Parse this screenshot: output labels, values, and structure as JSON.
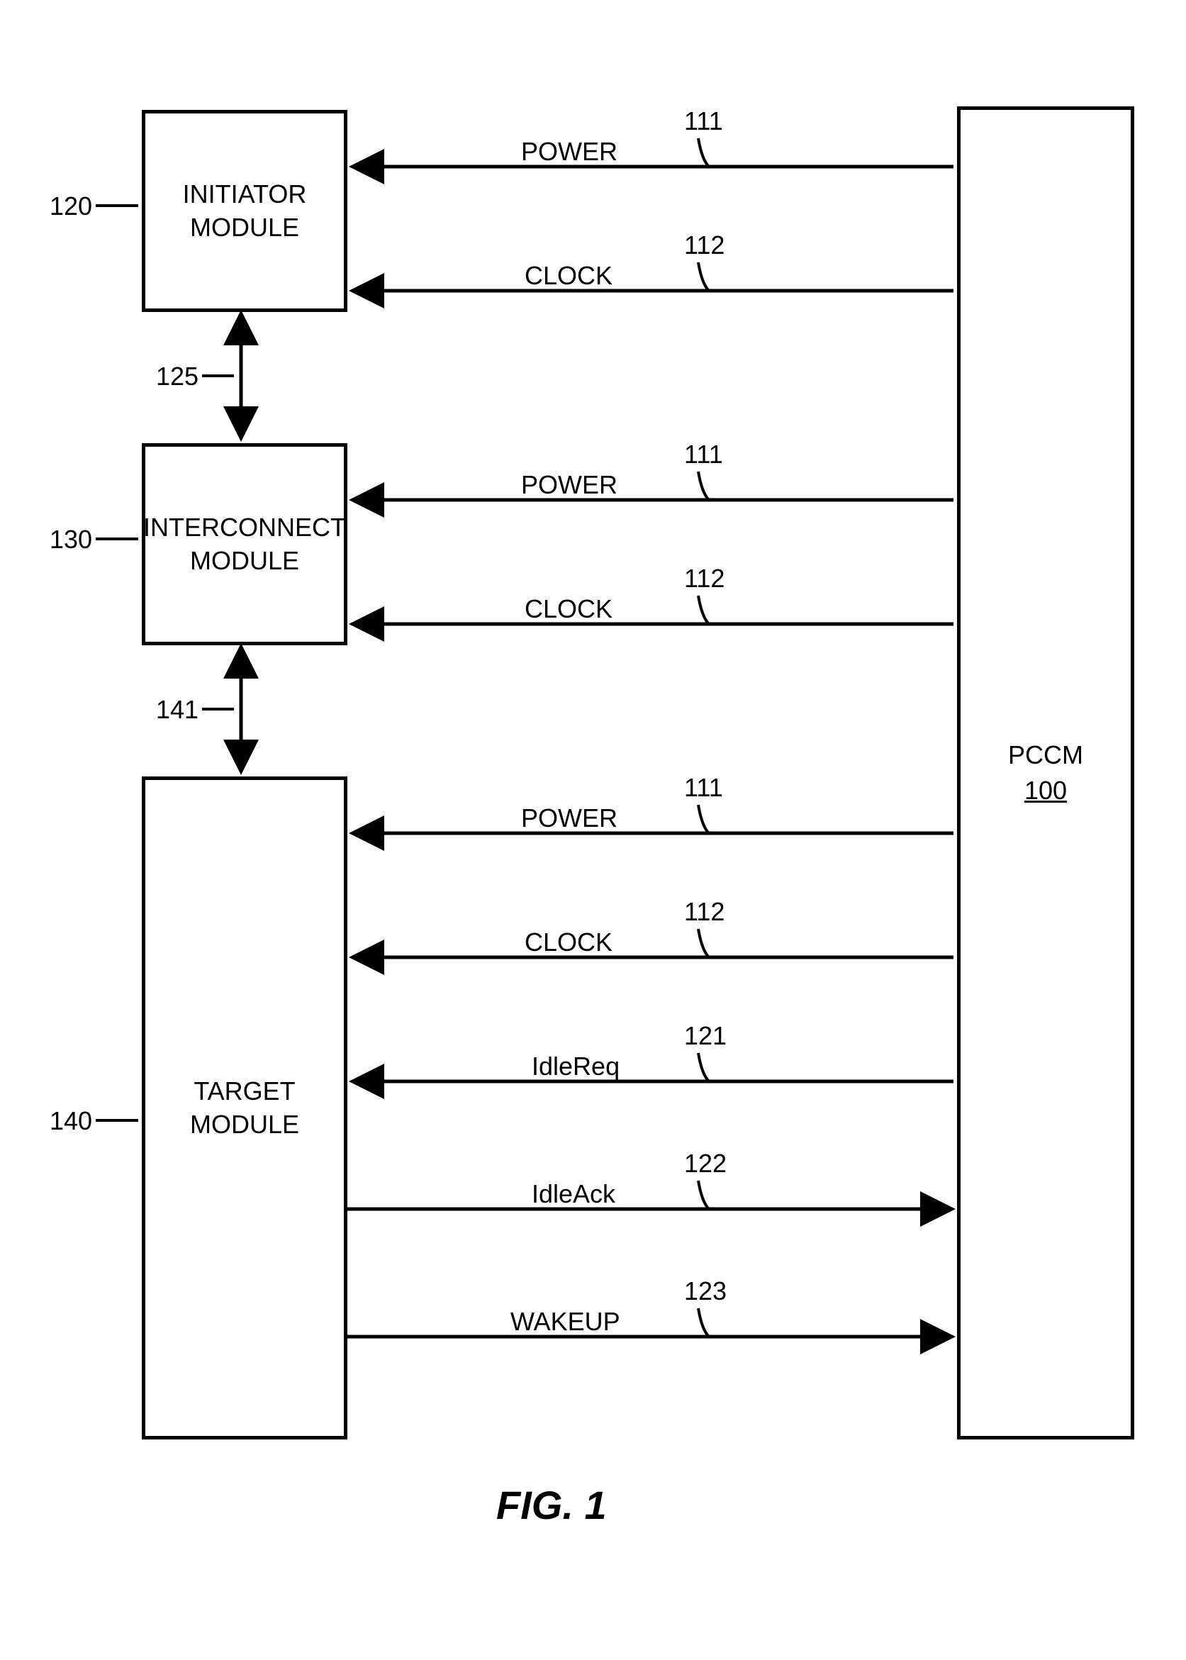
{
  "figure_label": "FIG. 1",
  "boxes": {
    "initiator": "INITIATOR\nMODULE",
    "interconnect": "INTERCONNECT\nMODULE",
    "target": "TARGET\nMODULE",
    "pccm_title": "PCCM",
    "pccm_num": "100"
  },
  "refs": {
    "initiator": "120",
    "interconnect": "130",
    "target": "140",
    "bus125": "125",
    "bus141": "141",
    "sig111": "111",
    "sig112": "112",
    "sig121": "121",
    "sig122": "122",
    "sig123": "123"
  },
  "signals": {
    "power": "POWER",
    "clock": "CLOCK",
    "idlereq": "IdleReq",
    "idleack": "IdleAck",
    "wakeup": "WAKEUP"
  }
}
